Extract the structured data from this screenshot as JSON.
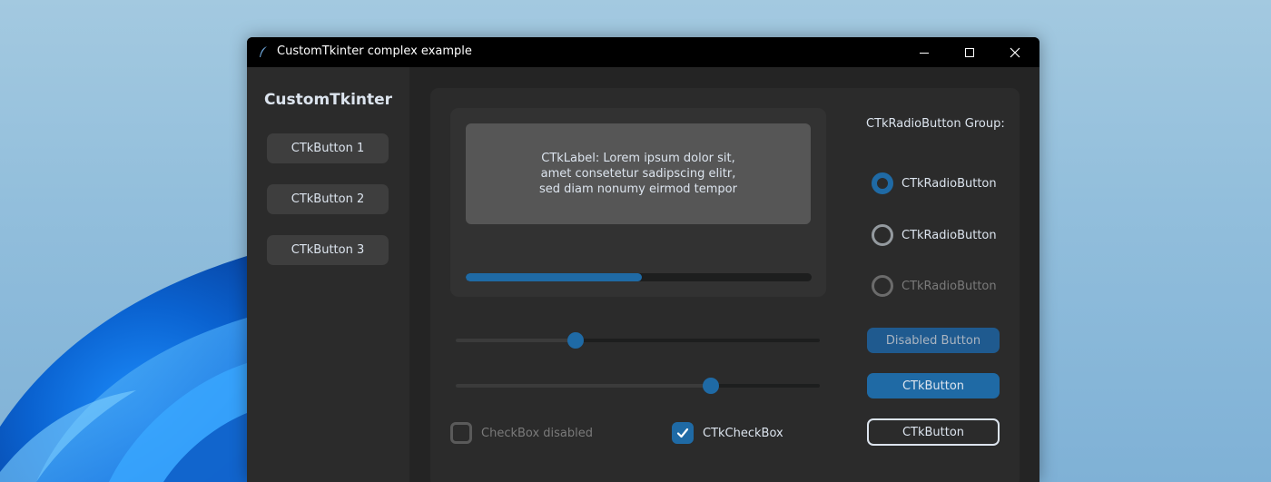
{
  "window": {
    "title": "CustomTkinter complex example"
  },
  "sidebar": {
    "logo": "CustomTkinter",
    "buttons": [
      {
        "label": "CTkButton 1"
      },
      {
        "label": "CTkButton 2"
      },
      {
        "label": "CTkButton 3"
      }
    ]
  },
  "main": {
    "label_text": "CTkLabel: Lorem ipsum dolor sit,\namet consetetur sadipscing elitr,\nsed diam nonumy eirmod tempor",
    "progress": 0.51,
    "sliders": [
      {
        "value": 0.33
      },
      {
        "value": 0.7
      }
    ],
    "checkboxes": [
      {
        "label": "CheckBox disabled",
        "checked": false,
        "disabled": true
      },
      {
        "label": "CTkCheckBox",
        "checked": true,
        "disabled": false
      }
    ]
  },
  "radio_group": {
    "label": "CTkRadioButton Group:",
    "options": [
      {
        "label": "CTkRadioButton",
        "selected": true,
        "disabled": false
      },
      {
        "label": "CTkRadioButton",
        "selected": false,
        "disabled": false
      },
      {
        "label": "CTkRadioButton",
        "selected": false,
        "disabled": true
      }
    ]
  },
  "right_buttons": {
    "disabled_label": "Disabled Button",
    "button_label": "CTkButton",
    "outline_label": "CTkButton"
  },
  "colors": {
    "accent": "#1f6aa5",
    "window_bg": "#242424",
    "frame_bg": "#2b2b2b",
    "text": "#dce4ee"
  }
}
